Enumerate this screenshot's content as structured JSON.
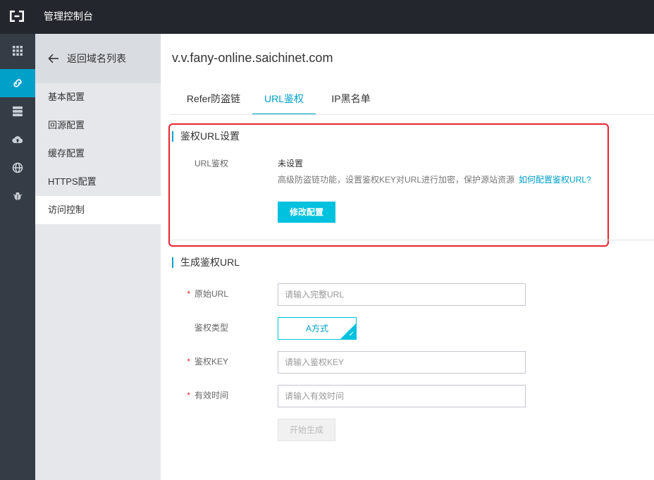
{
  "topbar": {
    "title": "管理控制台",
    "logo_icon": "aliyun-logo-icon"
  },
  "rail": {
    "items": [
      "grid-icon",
      "link-icon",
      "database-icon",
      "cloud-upload-icon",
      "globe-icon",
      "bug-icon"
    ],
    "active_index": 1,
    "accent": "#00a0c8"
  },
  "sidebar": {
    "back_label": "返回域名列表",
    "items": [
      {
        "label": "基本配置"
      },
      {
        "label": "回源配置"
      },
      {
        "label": "缓存配置"
      },
      {
        "label": "HTTPS配置"
      },
      {
        "label": "访问控制"
      }
    ],
    "active_index": 4
  },
  "main": {
    "domain": "v.v.fany-online.saichinet.com",
    "tabs": [
      {
        "label": "Refer防盗链"
      },
      {
        "label": "URL鉴权"
      },
      {
        "label": "IP黑名单"
      }
    ],
    "active_tab": 1,
    "auth_section": {
      "title": "鉴权URL设置",
      "field_label": "URL鉴权",
      "status": "未设置",
      "description": "高级防盗链功能，设置鉴权KEY对URL进行加密，保护源站资源",
      "help_link": "如何配置鉴权URL?",
      "modify_button": "修改配置"
    },
    "generate_section": {
      "title": "生成鉴权URL",
      "original_url": {
        "label": "原始URL",
        "placeholder": "请输入完整URL",
        "required": "*"
      },
      "auth_type": {
        "label": "鉴权类型",
        "selected": "A方式"
      },
      "auth_key": {
        "label": "鉴权KEY",
        "placeholder": "请输入鉴权KEY",
        "required": "*"
      },
      "valid_time": {
        "label": "有效时间",
        "placeholder": "请输入有效时间",
        "required": "*"
      },
      "generate_button": "开始生成"
    }
  },
  "colors": {
    "accent": "#00a0c8",
    "button": "#00c1de",
    "highlight": "#e8232f",
    "topbar": "#23272d"
  }
}
